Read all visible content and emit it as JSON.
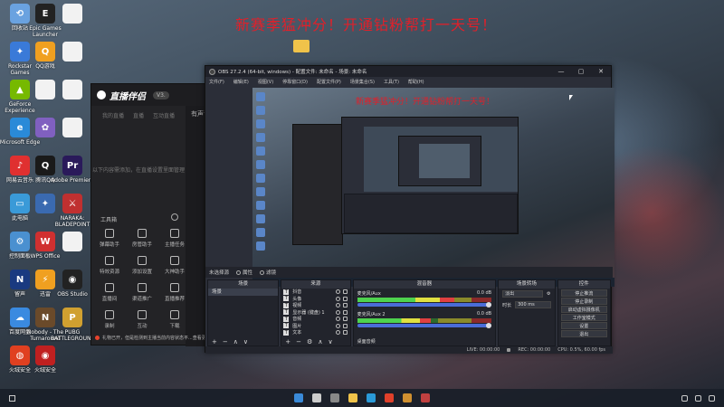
{
  "desktop": {
    "banner": "新赛季猛冲分！开通钻粉帮打一天号！",
    "icons": [
      {
        "label": "回收站",
        "color": "#6aa2e0",
        "glyph": "⟲"
      },
      {
        "label": "Epic Games Launcher",
        "color": "#222222",
        "glyph": "E"
      },
      {
        "label": "",
        "color": "#f2f2f2",
        "glyph": ""
      },
      {
        "label": "Rockstar Games",
        "color": "#3a7ad8",
        "glyph": "✦"
      },
      {
        "label": "QQ游戏",
        "color": "#f0a020",
        "glyph": "Q"
      },
      {
        "label": "",
        "color": "#f2f2f2",
        "glyph": ""
      },
      {
        "label": "GeForce Experience",
        "color": "#76b900",
        "glyph": "▲"
      },
      {
        "label": "",
        "color": "#f2f2f2",
        "glyph": ""
      },
      {
        "label": "",
        "color": "#f2f2f2",
        "glyph": ""
      },
      {
        "label": "Microsoft Edge",
        "color": "#2a8ad8",
        "glyph": "e"
      },
      {
        "label": "",
        "color": "#8060c0",
        "glyph": "✿"
      },
      {
        "label": "",
        "color": "#f2f2f2",
        "glyph": ""
      },
      {
        "label": "网易云音乐",
        "color": "#e03030",
        "glyph": "♪"
      },
      {
        "label": "腾讯QQ",
        "color": "#1a1a1a",
        "glyph": "Q"
      },
      {
        "label": "Adobe Premiere",
        "color": "#2a1a5a",
        "glyph": "Pr"
      },
      {
        "label": "此电脑",
        "color": "#3a9ad8",
        "glyph": "▭"
      },
      {
        "label": "",
        "color": "#3a6ab0",
        "glyph": "✦"
      },
      {
        "label": "NARAKA: BLADEPOINT",
        "color": "#c03030",
        "glyph": "⚔"
      },
      {
        "label": "控制面板",
        "color": "#4a90d0",
        "glyph": "⚙"
      },
      {
        "label": "WPS Office",
        "color": "#d03030",
        "glyph": "W"
      },
      {
        "label": "",
        "color": "#f2f2f2",
        "glyph": ""
      },
      {
        "label": "留声",
        "color": "#1a3a80",
        "glyph": "N"
      },
      {
        "label": "迅雷",
        "color": "#f0a020",
        "glyph": "⚡"
      },
      {
        "label": "OBS Studio",
        "color": "#222222",
        "glyph": "◉"
      },
      {
        "label": "百度网盘",
        "color": "#3a8ae0",
        "glyph": "☁"
      },
      {
        "label": "Nobody - The Turnaround",
        "color": "#6a4a2a",
        "glyph": "N"
      },
      {
        "label": "PUBG BATTLEGROUNDS",
        "color": "#d0a030",
        "glyph": "P"
      },
      {
        "label": "火绒安全",
        "color": "#e04020",
        "glyph": "◍"
      },
      {
        "label": "火绒安全",
        "color": "#c02020",
        "glyph": "◉"
      }
    ]
  },
  "live_app": {
    "brand": "直播伴侣",
    "version": "V3.",
    "tabs": [
      "我的直播",
      "直播",
      "互动直播"
    ],
    "empty_text": "以下内容需添加，在直播设置里面管理",
    "side_title": "有声音",
    "tools_title": "工具箱",
    "tools": [
      "弹幕助手",
      "房管助手",
      "主播任务",
      "特效资源",
      "添加设置",
      "大神助手",
      "直播间",
      "渠道推广",
      "直播推荐",
      "录制",
      "互动",
      "下载"
    ],
    "status": "礼物已开，但是检测到主播当前内容状态平...查看更多"
  },
  "obs": {
    "title": "OBS 27.2.4 (64-bit, windows) - 配置文件: 未命名 - 场景: 未命名",
    "window_controls": [
      "—",
      "▢",
      "✕"
    ],
    "menu": [
      "文件(F)",
      "编辑(E)",
      "视图(V)",
      "停靠窗口(D)",
      "配置文件(P)",
      "场景集合(S)",
      "工具(T)",
      "帮助(H)"
    ],
    "preview_banner": "新赛季猛冲分！开通钻粉帮打一天号！",
    "toolbar": {
      "no_source": "未选择源",
      "properties": "属性",
      "filters": "滤镜"
    },
    "docks": {
      "scenes": {
        "title": "场景",
        "items": [
          "场景"
        ]
      },
      "sources": {
        "title": "来源",
        "items": [
          "抖音",
          "头像",
          "视频",
          "显示器 (键盘) 1",
          "音频",
          "图片",
          "文本"
        ]
      },
      "mixer": {
        "title": "混音器",
        "channels": [
          {
            "name": "麦克风/Aux",
            "db": "0.0 dB",
            "level": 0.72
          },
          {
            "name": "麦克风/Aux 2",
            "db": "0.0 dB",
            "level": 0.55
          }
        ],
        "footer": "桌面音频"
      },
      "transitions": {
        "title": "场景转场",
        "type": "淡出",
        "duration_label": "时长",
        "duration_value": "300 ms"
      },
      "controls": {
        "title": "控件",
        "buttons": [
          "停止推流",
          "停止录制",
          "启动虚拟摄像机",
          "工作室模式",
          "设置",
          "退出"
        ]
      }
    },
    "statusbar": {
      "live": "LIVE: 00:00:00",
      "rec": "REC: 00:00:00",
      "cpu": "CPU: 0.5%, 60.00 fps"
    }
  },
  "taskbar": {
    "apps": [
      {
        "name": "start-menu",
        "color": "#3a8ad8"
      },
      {
        "name": "search",
        "color": "#cccccc"
      },
      {
        "name": "task-view",
        "color": "#888888"
      },
      {
        "name": "file-explorer",
        "color": "#f0c34a"
      },
      {
        "name": "edge",
        "color": "#2a9ad8"
      },
      {
        "name": "chrome",
        "color": "#e0402a"
      },
      {
        "name": "game",
        "color": "#d09030"
      },
      {
        "name": "obs",
        "color": "#c04040"
      }
    ]
  }
}
